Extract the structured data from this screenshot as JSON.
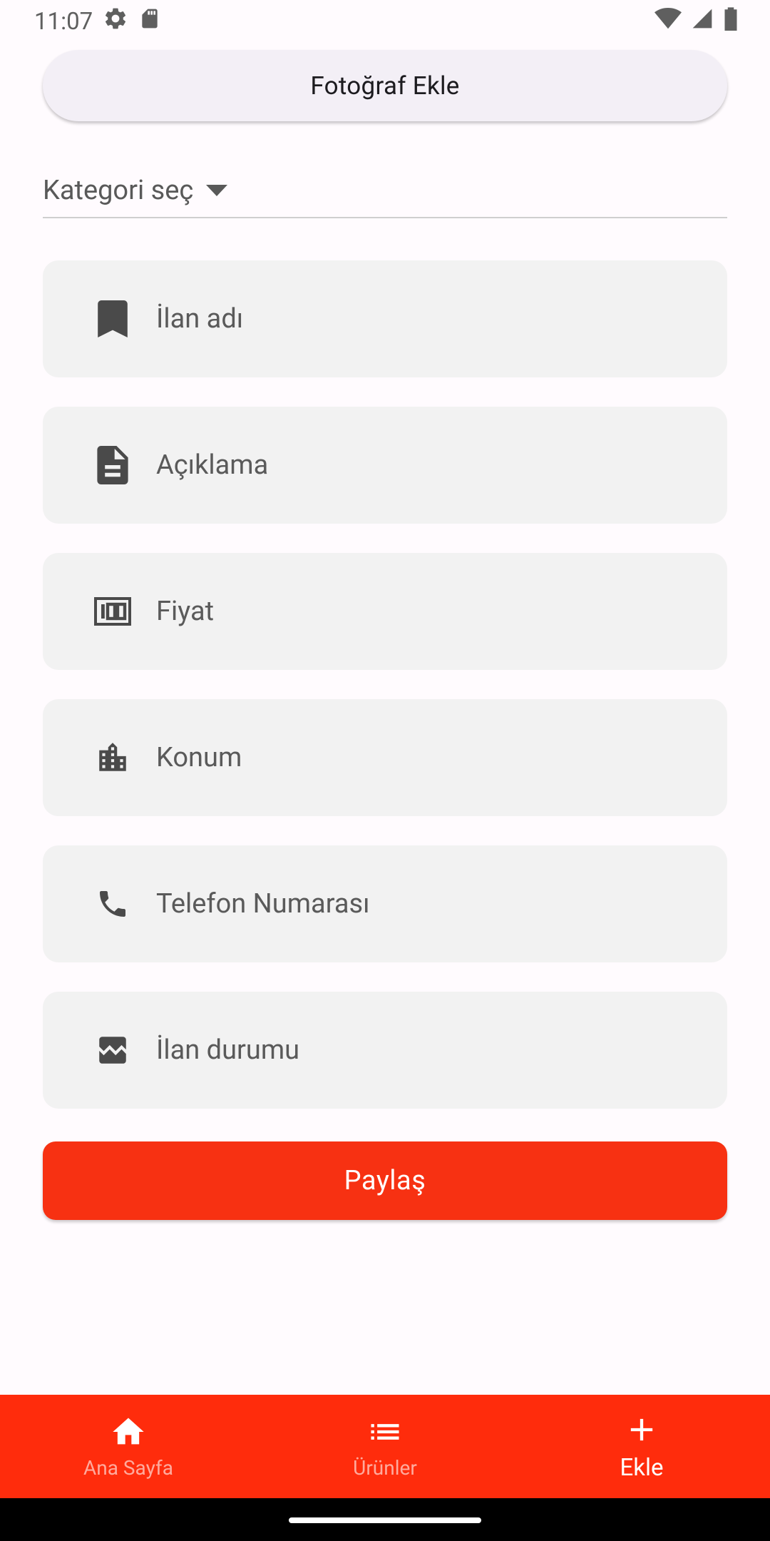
{
  "status_bar": {
    "time": "11:07",
    "icons": [
      "settings-icon",
      "sd-card-icon",
      "wifi-icon",
      "signal-icon",
      "battery-icon"
    ]
  },
  "form": {
    "photo_button_label": "Fotoğraf Ekle",
    "category_label": "Kategori seç",
    "fields": [
      {
        "icon": "bookmark-icon",
        "label": "İlan adı"
      },
      {
        "icon": "document-icon",
        "label": "Açıklama"
      },
      {
        "icon": "money-icon",
        "label": "Fiyat"
      },
      {
        "icon": "location-city-icon",
        "label": "Konum"
      },
      {
        "icon": "phone-icon",
        "label": "Telefon Numarası"
      },
      {
        "icon": "image-icon",
        "label": "İlan durumu"
      }
    ],
    "share_button_label": "Paylaş"
  },
  "bottom_nav": {
    "items": [
      {
        "icon": "home-icon",
        "label": "Ana Sayfa",
        "active": false
      },
      {
        "icon": "list-icon",
        "label": "Ürünler",
        "active": false
      },
      {
        "icon": "add-icon",
        "label": "Ekle",
        "active": true
      }
    ]
  },
  "colors": {
    "accent": "#F73112",
    "nav_background": "#FF2C0C",
    "field_background": "#F2F2F2",
    "page_background": "#FFFBFE"
  }
}
